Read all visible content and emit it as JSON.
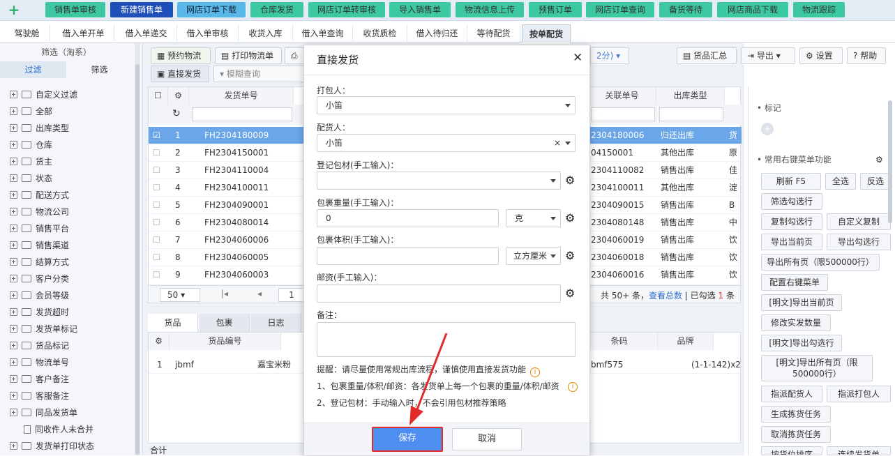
{
  "top_toolbar": [
    "销售单审核",
    "新建销售单",
    "网店订单下载",
    "仓库发货",
    "网店订单转审核",
    "导入销售单",
    "物流信息上传",
    "预售订单",
    "网店订单查询",
    "备货等待",
    "网店商品下载",
    "物流跟踪"
  ],
  "tabs": [
    "驾驶舱",
    "借入单开单",
    "借入单递交",
    "借入单审核",
    "收货入库",
    "借入单查询",
    "收货质检",
    "借入待归还",
    "等待配货",
    "按单配货"
  ],
  "left_panel": {
    "title": "筛选（淘系）",
    "tab_filter": "过滤",
    "tab_select": "筛选",
    "items": [
      "自定义过滤",
      "全部",
      "出库类型",
      "仓库",
      "货主",
      "状态",
      "配送方式",
      "物流公司",
      "销售平台",
      "销售渠道",
      "结算方式",
      "客户分类",
      "会员等级",
      "发货超时",
      "发货单标记",
      "货品标记",
      "物流单号",
      "客户备注",
      "客服备注",
      "同品发货单",
      "同收件人未合并",
      "发货单打印状态"
    ]
  },
  "toolbar": {
    "btn_reserve": "预约物流",
    "btn_print": "打印物流单",
    "btn_direct": "直接发货",
    "fuzzy": "模糊查询",
    "hidden_tail": "2分)",
    "summary": "货品汇总",
    "export": "导出",
    "settings": "设置",
    "help": "帮助"
  },
  "grid": {
    "headers": [
      "发货单号",
      "关联单号",
      "出库类型"
    ],
    "rows": [
      {
        "n": "1",
        "code": "FH2304180009",
        "rel": "2304180006",
        "type": "归还出库",
        "x": "货"
      },
      {
        "n": "2",
        "code": "FH2304150001",
        "rel": "04150001",
        "type": "其他出库",
        "x": "原"
      },
      {
        "n": "3",
        "code": "FH2304110004",
        "rel": "2304110082",
        "type": "销售出库",
        "x": "佳"
      },
      {
        "n": "4",
        "code": "FH2304100011",
        "rel": "2304100011",
        "type": "其他出库",
        "x": "淀"
      },
      {
        "n": "5",
        "code": "FH2304090001",
        "rel": "2304090015",
        "type": "销售出库",
        "x": "B"
      },
      {
        "n": "6",
        "code": "FH2304080014",
        "rel": "2304080148",
        "type": "销售出库",
        "x": "中"
      },
      {
        "n": "7",
        "code": "FH2304060006",
        "rel": "2304060019",
        "type": "销售出库",
        "x": "饮"
      },
      {
        "n": "8",
        "code": "FH2304060005",
        "rel": "2304060018",
        "type": "销售出库",
        "x": "饮"
      },
      {
        "n": "9",
        "code": "FH2304060003",
        "rel": "2304060016",
        "type": "销售出库",
        "x": "饮"
      }
    ],
    "page_size": "50",
    "page_num": "1",
    "total_pre": "共 50+ 条，",
    "total_link": "查看总数",
    "total_mid": " | 已勾选 ",
    "total_sel": "1",
    "total_post": " 条"
  },
  "bottom": {
    "tabs": [
      "货品",
      "包裹",
      "日志"
    ],
    "headers": [
      "货品编号",
      "条码",
      "品牌"
    ],
    "row": {
      "n": "1",
      "code": "jbmf",
      "name": "嘉宝米粉",
      "bar": "bmf575",
      "pos": "(1-1-142)x2"
    },
    "footer": "合计"
  },
  "right_panel": {
    "tag_label": "标记",
    "menu_label": "常用右键菜单功能",
    "buttons": [
      "刷新  F5",
      "全选",
      "反选",
      "筛选勾选行",
      "复制勾选行",
      "自定义复制",
      "导出当前页",
      "导出勾选行",
      "导出所有页（限500000行）",
      "配置右键菜单",
      "[明文]导出当前页",
      "修改实发数量",
      "[明文]导出勾选行",
      "[明文]导出所有页（限500000行）",
      "指派配货人",
      "指派打包人",
      "生成拣货任务",
      "取消拣货任务",
      "按货位排序",
      "连续发货单"
    ]
  },
  "modal": {
    "title": "直接发货",
    "packer_label": "打包人：",
    "packer_value": "小笛",
    "picker_label": "配货人：",
    "picker_value": "小笛",
    "material_label": "登记包材(手工输入)：",
    "weight_label": "包裹重量(手工输入)：",
    "weight_value": "0",
    "weight_unit": "克",
    "volume_label": "包裹体积(手工输入)：",
    "volume_unit": "立方厘米",
    "postage_label": "邮资(手工输入)：",
    "remark_label": "备注：",
    "tip1": "提醒：请尽量使用常规出库流程，谨慎使用直接发货功能",
    "tip2": "1、包裹重量/体积/邮资：各发货单上每一个包裹的重量/体积/邮资",
    "tip3": "2、登记包材：手动输入时，不会引用包材推荐策略",
    "save": "保存",
    "cancel": "取消"
  }
}
